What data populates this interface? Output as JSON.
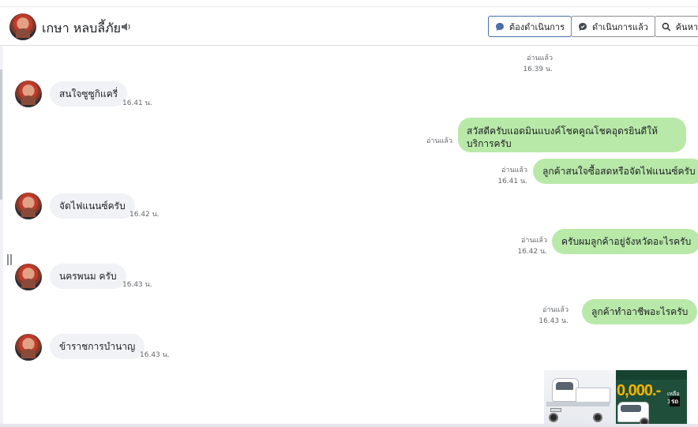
{
  "header": {
    "contact_name": "เกษา หลบลี้ภัย",
    "buttons": {
      "todo": "ต้องดำเนินการ",
      "done": "ดำเนินการแล้ว",
      "search": "ค้นหา"
    }
  },
  "icons": {
    "speaker": "speaker-icon",
    "todo": "chat-bubble-icon",
    "done": "chat-bubble-check-icon",
    "search": "search-icon"
  },
  "colors": {
    "outgoing_bubble": "#b9e9a9",
    "incoming_bubble": "#f0f2f5",
    "primary_border": "#4a6ea9"
  },
  "messages": [
    {
      "dir": "out",
      "text": "",
      "status": "อ่านแล้ว",
      "time": "16.39 น."
    },
    {
      "dir": "in",
      "text": "สนใจซูซูกิแครี่",
      "time": "16.41 น."
    },
    {
      "dir": "out",
      "text": "สวัสดีครับแอดมินแบงค์โชคคูณโชคอุดรยินดีให้บริการครับ",
      "status": "อ่านแล้ว",
      "time": ""
    },
    {
      "dir": "out",
      "text": "ลูกค้าสนใจซื้อสดหรือจัดไฟแนนซ์ครับ",
      "status": "อ่านแล้ว",
      "time": "16.41 น."
    },
    {
      "dir": "in",
      "text": "จัดไฟแนนซ์ครับ",
      "time": "16.42 น."
    },
    {
      "dir": "out",
      "text": "ครับผมลูกค้าอยู่จังหวัดอะไรครับ",
      "status": "อ่านแล้ว",
      "time": "16.42 น."
    },
    {
      "dir": "in",
      "text": "นครพนม ครับ",
      "time": "16.43 น."
    },
    {
      "dir": "out",
      "text": "ลูกค้าทำอาชีพอะไรครับ",
      "status": "อ่านแล้ว",
      "time": "16.43 น."
    },
    {
      "dir": "in",
      "text": "ข้าราชการบำนาญ",
      "time": "16.43 น."
    }
  ],
  "attachment": {
    "promo_price": "0,000.-",
    "promo_small": "เหลือ 1.45",
    "promo_word": "รถ"
  }
}
